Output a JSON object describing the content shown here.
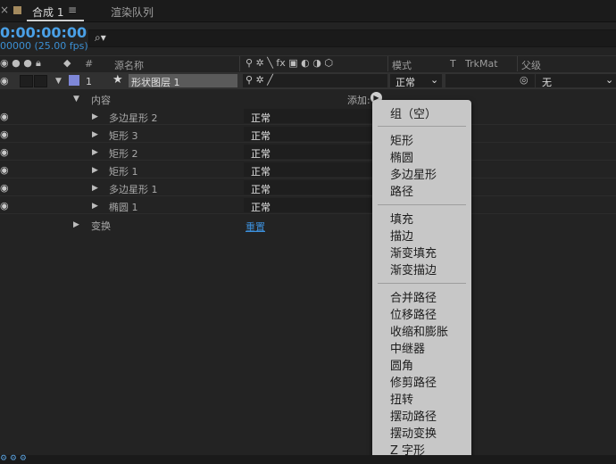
{
  "tabs": {
    "close": "×",
    "comp": "合成 1",
    "menu": "≡",
    "render_queue": "渲染队列"
  },
  "timecode": {
    "time": "0:00:00:00",
    "fps": "00000 (25.00 fps)"
  },
  "search": {
    "placeholder": "",
    "icon": "search-icon"
  },
  "columns": {
    "hash": "#",
    "source_name": "源名称",
    "switch_icons": "⚲ ✲ ╲ fx ▣ ◐ ◑ ⬡",
    "mode": "模式",
    "t": "T",
    "trkmat": "TrkMat",
    "parent": "父级"
  },
  "layer": {
    "number": "1",
    "star": "★",
    "name": "形状图层 1",
    "mode": "正常",
    "parent": "无",
    "color": "#7e87d8"
  },
  "contents": {
    "label": "内容",
    "add_label": "添加:",
    "items": [
      {
        "name": "多边星形 2",
        "mode": "正常"
      },
      {
        "name": "矩形 3",
        "mode": "正常"
      },
      {
        "name": "矩形 2",
        "mode": "正常"
      },
      {
        "name": "矩形 1",
        "mode": "正常"
      },
      {
        "name": "多边星形 1",
        "mode": "正常"
      },
      {
        "name": "椭圆 1",
        "mode": "正常"
      }
    ]
  },
  "transform": {
    "label": "变换",
    "reset": "重置"
  },
  "menu": {
    "group": "组（空）",
    "shapes": [
      "矩形",
      "椭圆",
      "多边星形",
      "路径"
    ],
    "fills": [
      "填充",
      "描边",
      "渐变填充",
      "渐变描边"
    ],
    "ops": [
      "合并路径",
      "位移路径",
      "收缩和膨胀",
      "中继器",
      "圆角",
      "修剪路径",
      "扭转",
      "摆动路径",
      "摆动变换",
      "Z 字形"
    ]
  }
}
